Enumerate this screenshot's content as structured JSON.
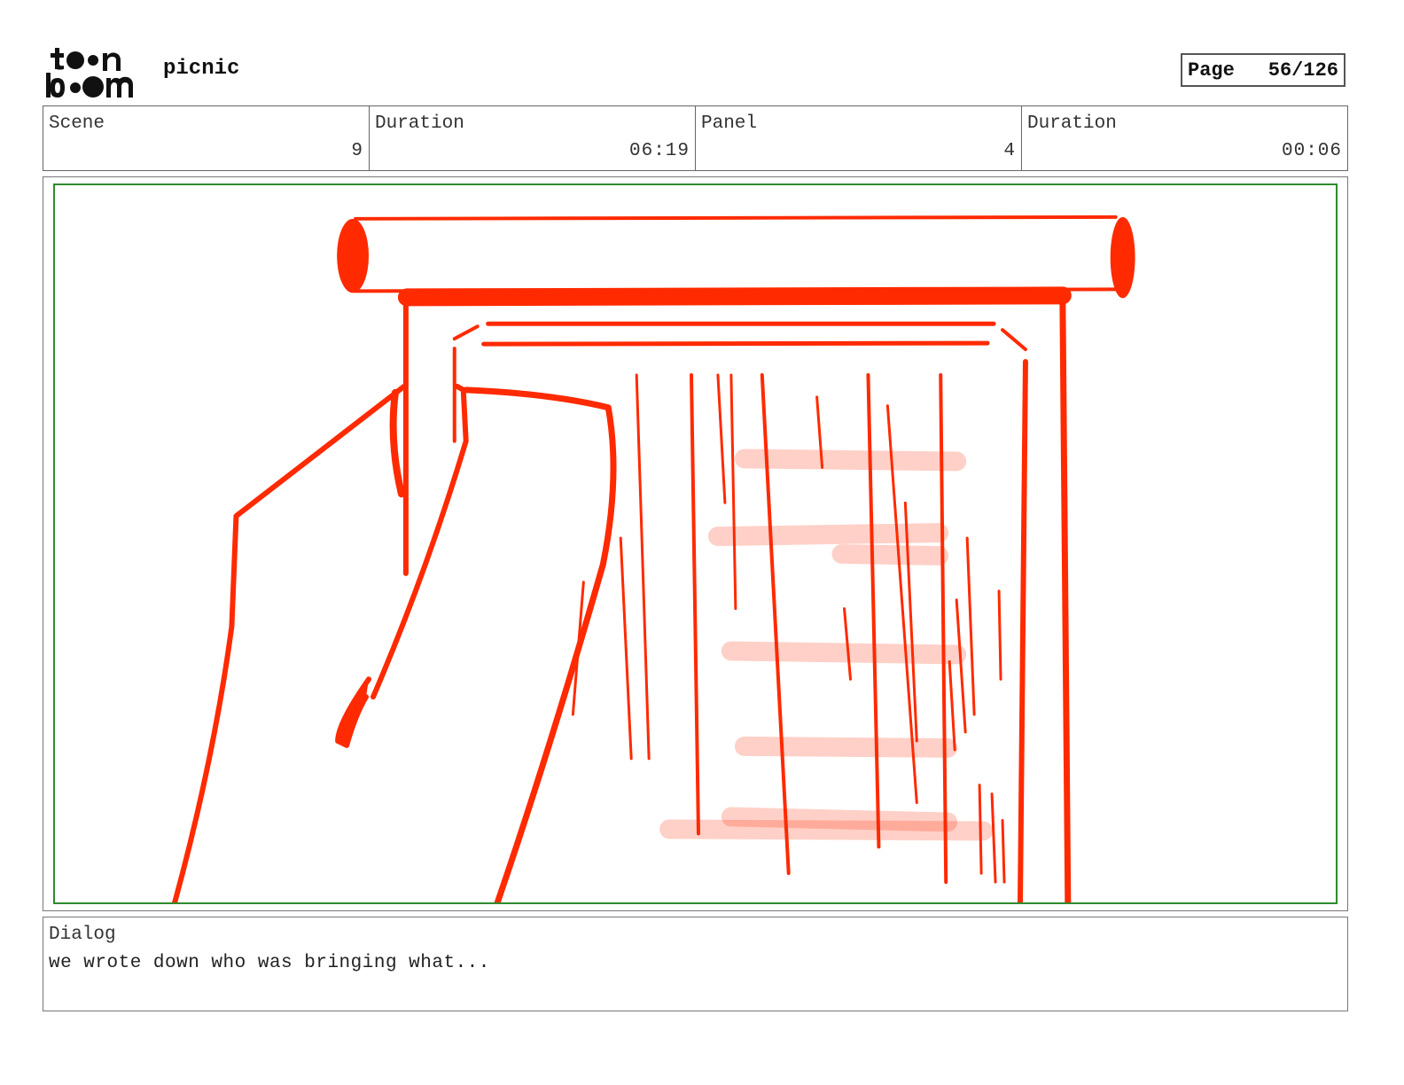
{
  "header": {
    "logo_text": "toon boom",
    "project_title": "picnic",
    "page_label": "Page",
    "page_number": "56/126"
  },
  "info": {
    "scene_label": "Scene",
    "scene_value": "9",
    "scene_duration_label": "Duration",
    "scene_duration_value": "06:19",
    "panel_label": "Panel",
    "panel_value": "4",
    "panel_duration_label": "Duration",
    "panel_duration_value": "00:06"
  },
  "dialog": {
    "label": "Dialog",
    "text": "we wrote down who was bringing what..."
  },
  "colors": {
    "sketch_line": "#ff2a00",
    "safe_area_border": "#2e8b2e"
  }
}
